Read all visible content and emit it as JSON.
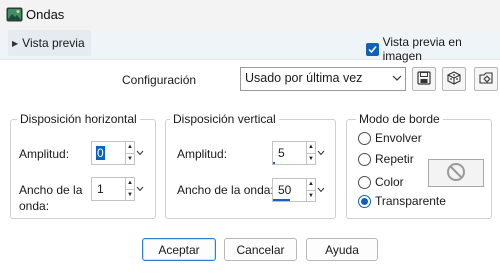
{
  "window": {
    "title": "Ondas",
    "app_icon": "photo-app-icon"
  },
  "preview": {
    "toggle_label": "Vista previa",
    "toggle_icon": "chevron-right-icon",
    "live_preview_label": "Vista previa en imagen",
    "live_preview_checked": true
  },
  "config": {
    "label": "Configuración",
    "preset_value": "Usado por última vez",
    "buttons": [
      "save-preset-icon",
      "randomize-icon",
      "preset-settings-icon"
    ]
  },
  "horizontal": {
    "title": "Disposición horizontal",
    "amplitude_label": "Amplitud:",
    "amplitude_value": "0",
    "wavelength_label_line1": "Ancho de la",
    "wavelength_label_line2": "onda:",
    "wavelength_value": "1"
  },
  "vertical": {
    "title": "Disposición vertical",
    "amplitude_label": "Amplitud:",
    "amplitude_value": "5",
    "amplitude_slider": 0.05,
    "wavelength_label": "Ancho de la onda:",
    "wavelength_value": "50",
    "wavelength_slider": 0.5
  },
  "edge_mode": {
    "title": "Modo de borde",
    "options": [
      "Envolver",
      "Repetir",
      "Color",
      "Transparente"
    ],
    "selected": "Transparente",
    "swatch_icon": "no-color-icon"
  },
  "buttons": {
    "ok": "Aceptar",
    "cancel": "Cancelar",
    "help": "Ayuda"
  },
  "colors": {
    "accent": "#1060b8",
    "title_bar": "#f3f3f3",
    "preview_bar": "#eff4f9"
  }
}
